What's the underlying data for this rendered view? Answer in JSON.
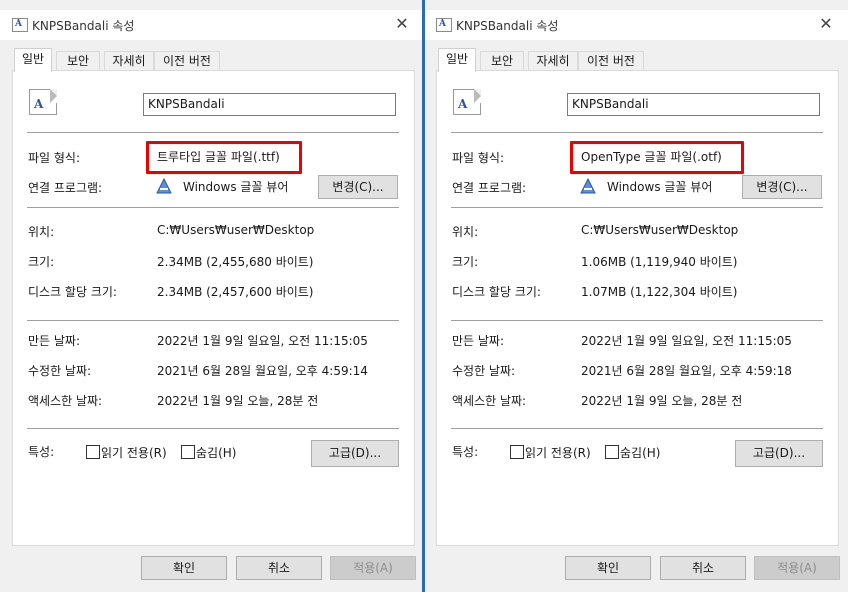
{
  "dialogs": [
    {
      "title": "KNPSBandali 속성",
      "tabs": [
        "일반",
        "보안",
        "자세히",
        "이전 버전"
      ],
      "file_name": "KNPSBandali",
      "labels": {
        "type": "파일 형식:",
        "opens_with": "연결 프로그램:",
        "location": "위치:",
        "size": "크기:",
        "size_on_disk": "디스크 할당 크기:",
        "created": "만든 날짜:",
        "modified": "수정한 날짜:",
        "accessed": "액세스한 날짜:",
        "attributes": "특성:"
      },
      "file_type": "트루타입 글꼴 파일(.ttf)",
      "opens_with_app": "Windows 글꼴 뷰어",
      "change_button": "변경(C)...",
      "location": "C:₩Users₩user₩Desktop",
      "size": "2.34MB (2,455,680 바이트)",
      "size_on_disk": "2.34MB (2,457,600 바이트)",
      "created": "2022년 1월 9일 일요일, 오전 11:15:05",
      "modified": "2021년 6월 28일 월요일, 오후 4:59:14",
      "accessed": "2022년 1월 9일 오늘, 28분 전",
      "readonly_label": "읽기 전용(R)",
      "hidden_label": "숨김(H)",
      "advanced_button": "고급(D)...",
      "ok_button": "확인",
      "cancel_button": "취소",
      "apply_button": "적용(A)"
    },
    {
      "title": "KNPSBandali 속성",
      "tabs": [
        "일반",
        "보안",
        "자세히",
        "이전 버전"
      ],
      "file_name": "KNPSBandali",
      "labels": {
        "type": "파일 형식:",
        "opens_with": "연결 프로그램:",
        "location": "위치:",
        "size": "크기:",
        "size_on_disk": "디스크 할당 크기:",
        "created": "만든 날짜:",
        "modified": "수정한 날짜:",
        "accessed": "액세스한 날짜:",
        "attributes": "특성:"
      },
      "file_type": "OpenType 글꼴 파일(.otf)",
      "opens_with_app": "Windows 글꼴 뷰어",
      "change_button": "변경(C)...",
      "location": "C:₩Users₩user₩Desktop",
      "size": "1.06MB (1,119,940 바이트)",
      "size_on_disk": "1.07MB (1,122,304 바이트)",
      "created": "2022년 1월 9일 일요일, 오전 11:15:05",
      "modified": "2021년 6월 28일 월요일, 오후 4:59:18",
      "accessed": "2022년 1월 9일 오늘, 28분 전",
      "readonly_label": "읽기 전용(R)",
      "hidden_label": "숨김(H)",
      "advanced_button": "고급(D)...",
      "ok_button": "확인",
      "cancel_button": "취소",
      "apply_button": "적용(A)"
    }
  ],
  "colors": {
    "highlight": "#ee0000",
    "divider": "#2b6db5",
    "font_icon_letter": "#2c55a8"
  },
  "icons": {
    "title": "font-file-icon",
    "file": "font-file-icon",
    "app": "font-viewer-icon",
    "close": "close-icon"
  }
}
